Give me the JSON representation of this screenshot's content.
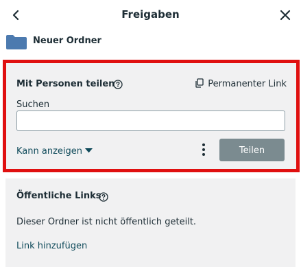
{
  "header": {
    "title": "Freigaben"
  },
  "folder": {
    "name": "Neuer Ordner",
    "color": "#4c7aaf"
  },
  "share_with_people": {
    "title": "Mit Personen teilen",
    "permanent_link_label": "Permanenter Link",
    "search_label": "Suchen",
    "search_value": "",
    "permission_label": "Kann anzeigen",
    "share_button_label": "Teilen"
  },
  "public_links": {
    "title": "Öffentliche Links",
    "description": "Dieser Ordner ist nicht öffentlich geteilt.",
    "add_link_label": "Link hinzufügen"
  },
  "colors": {
    "highlight_border": "#e01010",
    "panel_background": "#f1f1f2",
    "share_button": "#7b8b90",
    "link_text": "#0f4a5a"
  }
}
